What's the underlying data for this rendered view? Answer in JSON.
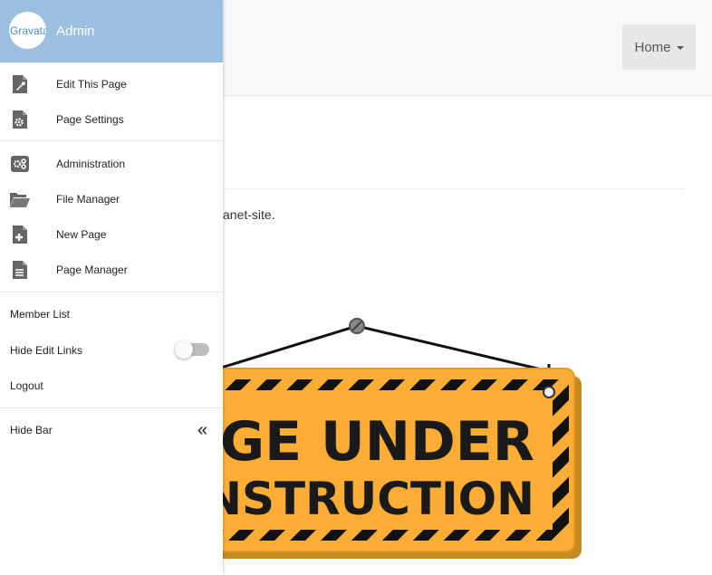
{
  "navbar": {
    "home_label": "Home"
  },
  "content": {
    "text_fragment": "anet-site."
  },
  "sign": {
    "line1": "AGE UNDER",
    "line2": "ONSTRUCTION"
  },
  "sidebar": {
    "avatar_alt": "Gravatar",
    "user_name": "Admin",
    "items": [
      {
        "label": "Edit This Page",
        "icon": "edit-page-icon"
      },
      {
        "label": "Page Settings",
        "icon": "page-settings-icon"
      },
      {
        "label": "Administration",
        "icon": "administration-icon"
      },
      {
        "label": "File Manager",
        "icon": "folder-icon"
      },
      {
        "label": "New Page",
        "icon": "new-page-icon"
      },
      {
        "label": "Page Manager",
        "icon": "page-manager-icon"
      },
      {
        "label": "Member List"
      },
      {
        "label": "Hide Edit Links"
      },
      {
        "label": "Logout"
      },
      {
        "label": "Hide Bar",
        "icon": "double-chevron-left-icon"
      }
    ],
    "hide_edit_links_enabled": false
  },
  "colors": {
    "sidebar_header": "#9abfdf",
    "sign_yellow": "#fbad36"
  }
}
